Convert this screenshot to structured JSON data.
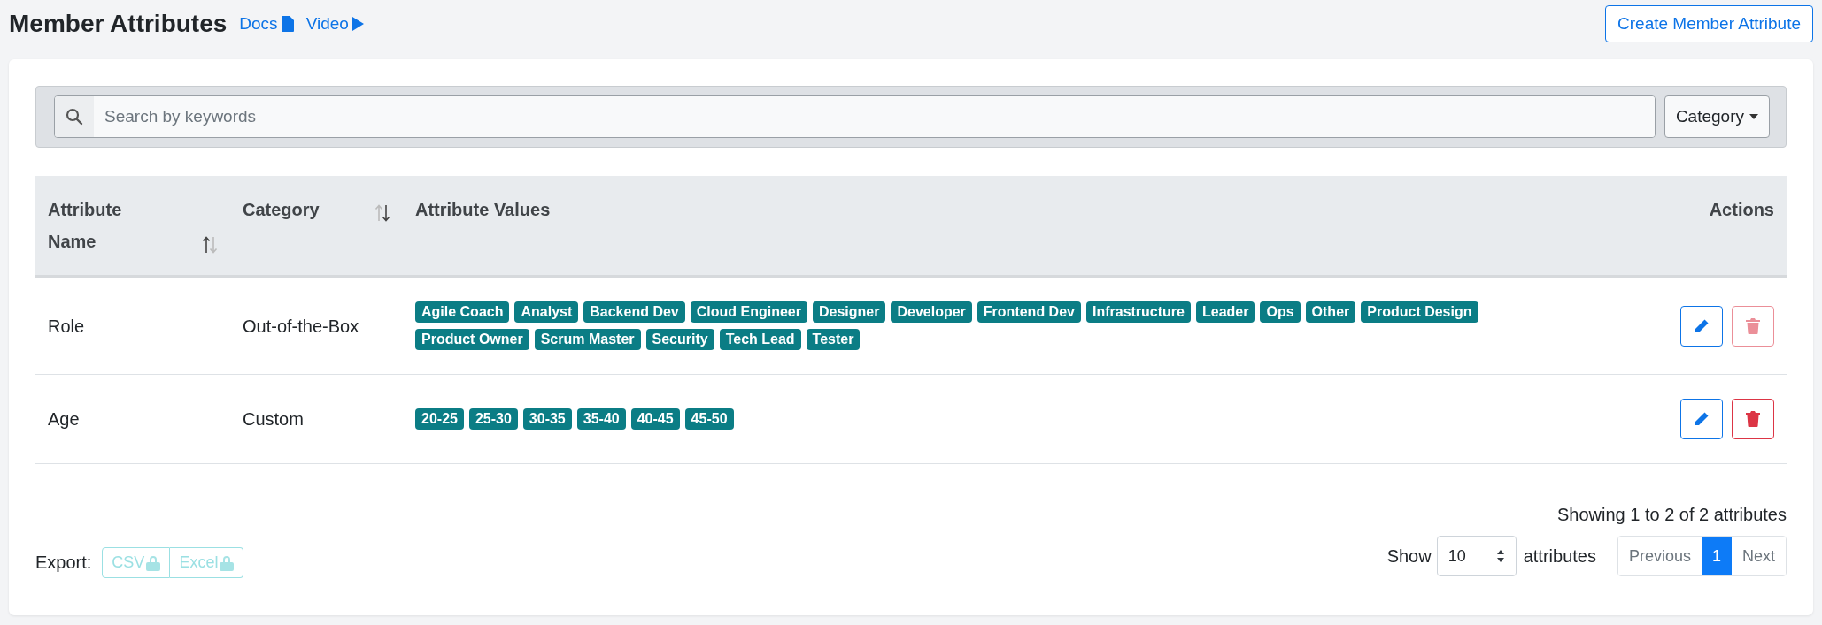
{
  "header": {
    "title": "Member Attributes",
    "links": [
      {
        "label": "Docs",
        "kind": "doc"
      },
      {
        "label": "Video",
        "kind": "video"
      }
    ],
    "create_button": "Create Member Attribute"
  },
  "filters": {
    "search": {
      "placeholder": "Search by keywords"
    },
    "category_dropdown": "Category"
  },
  "table": {
    "columns": [
      {
        "label": "Attribute Name",
        "sortable": true,
        "ascending": true
      },
      {
        "label": "Category",
        "sortable": true,
        "ascending": false
      },
      {
        "label": "Attribute Values",
        "sortable": false
      },
      {
        "label": "Actions",
        "sortable": false
      }
    ],
    "rows": [
      {
        "name": "Role",
        "category": "Out-of-the-Box",
        "values": [
          "Agile Coach",
          "Analyst",
          "Backend Dev",
          "Cloud Engineer",
          "Designer",
          "Developer",
          "Frontend Dev",
          "Infrastructure",
          "Leader",
          "Ops",
          "Other",
          "Product Design",
          "Product Owner",
          "Scrum Master",
          "Security",
          "Tech Lead",
          "Tester"
        ],
        "delete_disabled": true
      },
      {
        "name": "Age",
        "category": "Custom",
        "values": [
          "20-25",
          "25-30",
          "30-35",
          "35-40",
          "40-45",
          "45-50"
        ],
        "delete_disabled": false
      }
    ]
  },
  "footer": {
    "summary": "Showing 1 to 2 of 2 attributes",
    "export_label": "Export:",
    "export_buttons": [
      {
        "label": "CSV",
        "locked": true
      },
      {
        "label": "Excel",
        "locked": true
      }
    ],
    "show_label": "Show",
    "page_size": "10",
    "page_size_suffix": "attributes",
    "pagination": [
      {
        "label": "Previous",
        "selected": false
      },
      {
        "label": "1",
        "selected": true
      },
      {
        "label": "Next",
        "selected": false
      }
    ]
  }
}
